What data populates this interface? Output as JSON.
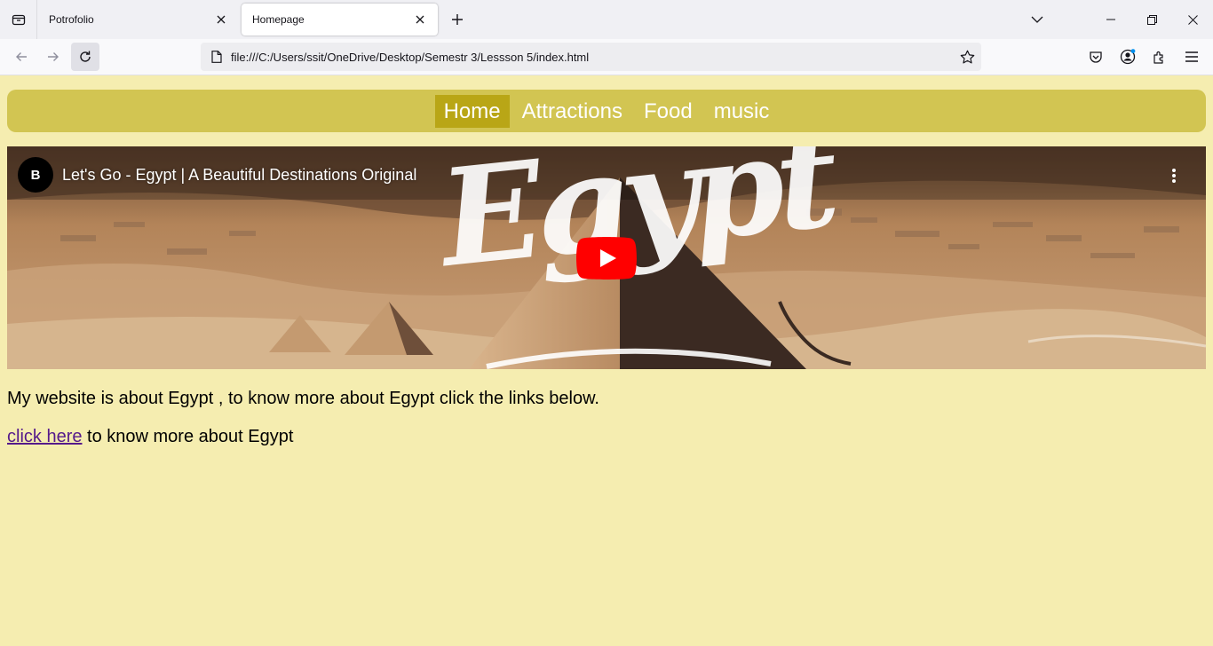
{
  "browser": {
    "tabs": [
      {
        "title": "Potrofolio",
        "active": false
      },
      {
        "title": "Homepage",
        "active": true
      }
    ],
    "url": "file:///C:/Users/ssit/OneDrive/Desktop/Semestr 3/Lessson 5/index.html"
  },
  "site_nav": {
    "items": [
      {
        "label": "Home",
        "active": true
      },
      {
        "label": "Attractions",
        "active": false
      },
      {
        "label": "Food",
        "active": false
      },
      {
        "label": "music",
        "active": false
      }
    ]
  },
  "video": {
    "title": "Let's Go - Egypt | A Beautiful Destinations Original",
    "channel_avatar_letter": "B",
    "thumbnail_text": "Egypt"
  },
  "content": {
    "intro": "My website is about Egypt , to know more about Egypt click the links below.",
    "link_text": "click here",
    "link_suffix": " to know more about Egypt"
  },
  "colors": {
    "page_bg": "#f5edb0",
    "nav_bg": "#d2c552",
    "nav_active_bg": "#b9a616",
    "youtube_red": "#ff0000",
    "visited_link": "#551a8b"
  }
}
